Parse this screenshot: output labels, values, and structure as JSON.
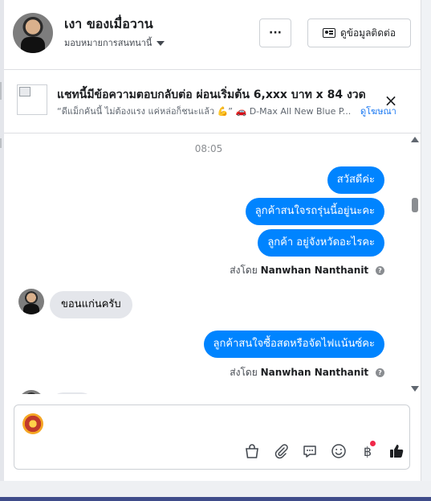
{
  "header": {
    "contact_name": "เงา ของเมื่อวาน",
    "assign_label": "มอบหมายการสนทนานี้",
    "more_label": "···",
    "contact_info_label": "ดูข้อมูลติดต่อ"
  },
  "ad_banner": {
    "title": "แชทนี้มีข้อความตอบกลับต่อ ผ่อนเริ่มต้น 6,xxx บาท x 84 งวด",
    "description": "“ดีแม็กคันนี้ ไม่ต้องแรง แค่หล่อก็ชนะแล้ว 💪” 🚗 D-Max All New Blue P...",
    "link_label": "ดูโฆษณา",
    "close_label": "×"
  },
  "thread": {
    "timestamp": "08:05",
    "outgoing_group_1": [
      "สวัสดีค่ะ",
      "ลูกค้าสนใจรถรุ่นนี้อยู่นะคะ",
      "ลูกค้า   อยู่จังหวัดอะไรคะ"
    ],
    "sent_by_1": {
      "prefix": "ส่งโดย",
      "name": "Nanwhan Nanthanit"
    },
    "incoming_1": "ขอนแก่นครับ",
    "outgoing_group_2": [
      "ลูกค้าสนใจซื้อสดหรือจัดไฟแน้นซ์คะ"
    ],
    "sent_by_2": {
      "prefix": "ส่งโดย",
      "name": "Nanwhan Nanthanit"
    },
    "help_icon_glyph": "?"
  },
  "composer": {
    "message_value": "",
    "tools": [
      "shopping-bag-icon",
      "paperclip-icon",
      "saved-replies-icon",
      "emoji-icon",
      "baht-payment-icon",
      "thumbs-up-icon"
    ],
    "baht_glyph": "฿"
  },
  "colors": {
    "outgoing_bubble": "#0084ff",
    "incoming_bubble": "#e4e6eb",
    "link": "#1877f2",
    "notification_dot": "#f02849"
  }
}
